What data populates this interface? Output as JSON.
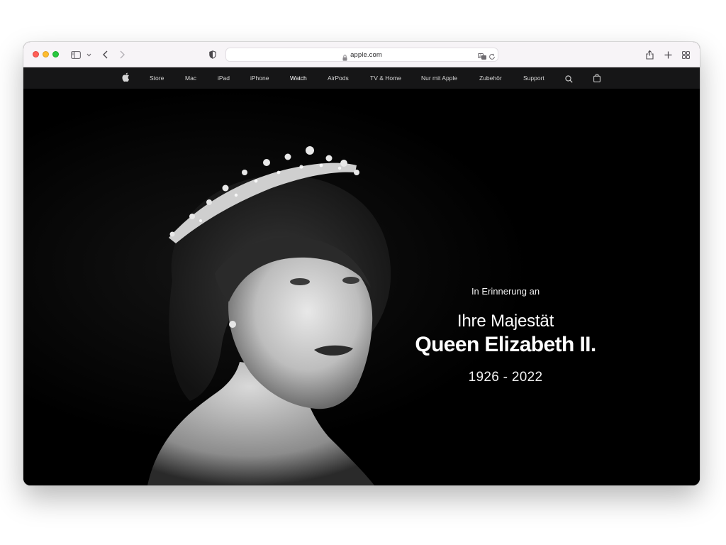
{
  "browser": {
    "url": "apple.com"
  },
  "nav": {
    "items": [
      {
        "label": "Store"
      },
      {
        "label": "Mac"
      },
      {
        "label": "iPad"
      },
      {
        "label": "iPhone"
      },
      {
        "label": "Watch"
      },
      {
        "label": "AirPods"
      },
      {
        "label": "TV & Home"
      },
      {
        "label": "Nur mit Apple"
      },
      {
        "label": "Zubehör"
      },
      {
        "label": "Support"
      }
    ],
    "active": "Watch"
  },
  "hero": {
    "memory_label": "In Erinnerung an",
    "majesty_label": "Ihre Majestät",
    "name": "Queen Elizabeth II.",
    "years": "1926 - 2022"
  },
  "icons": {
    "logo": "apple-logo-icon",
    "search": "search-icon",
    "bag": "shopping-bag-icon"
  },
  "colors": {
    "nav_background": "#161617",
    "hero_background": "#000000",
    "toolbar_background": "#f7f4f7"
  }
}
